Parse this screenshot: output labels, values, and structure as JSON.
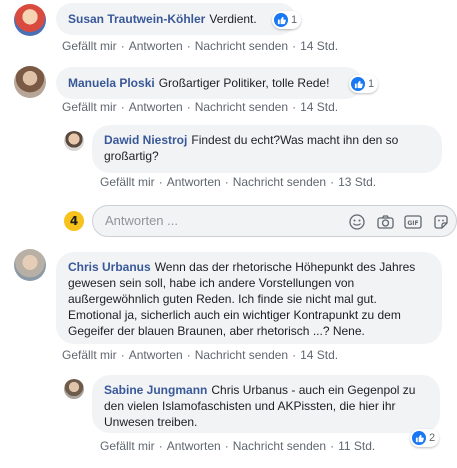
{
  "actions": {
    "like": "Gefällt mir",
    "reply": "Antworten",
    "message": "Nachricht senden",
    "separator": "·"
  },
  "comments": [
    {
      "author": "Susan Trautwein-Köhler",
      "text": "Verdient.",
      "time": "14 Std.",
      "reactions": "1",
      "avatar_icon": "profile-photo"
    },
    {
      "author": "Manuela Ploski",
      "text": "Großartiger Politiker, tolle Rede!",
      "time": "14 Std.",
      "reactions": "1",
      "avatar_icon": "profile-photo"
    },
    {
      "author": "Dawid Niestroj",
      "text": "Findest du echt?Was macht ihn den so großartig?",
      "time": "13 Std.",
      "avatar_icon": "profile-photo"
    },
    {
      "author": "Chris Urbanus",
      "text": "Wenn das der rhetorische Höhepunkt des Jahres gewesen sein soll, habe ich andere Vorstellungen von außergewöhnlich guten Reden. Ich finde sie nicht mal gut. Emotional ja, sicherlich auch ein wichtiger Kontrapunkt zu dem Gegeifer der blauen Braunen, aber rhetorisch ...? Nene.",
      "time": "14 Std.",
      "avatar_icon": "profile-photo"
    },
    {
      "author": "Sabine Jungmann",
      "text": "Chris Urbanus - auch ein Gegenpol zu den vielen Islamofaschisten und AKPissten, die hier ihr Unwesen treiben.",
      "time": "11 Std.",
      "reactions": "2",
      "avatar_icon": "profile-photo"
    }
  ],
  "reply_box": {
    "placeholder": "Antworten ...",
    "icons": [
      "emoji-icon",
      "camera-icon",
      "gif-icon",
      "sticker-icon"
    ]
  },
  "colors": {
    "author": "#385898",
    "bubble": "#f2f3f5",
    "meta": "#606770",
    "like": "#1877f2"
  }
}
